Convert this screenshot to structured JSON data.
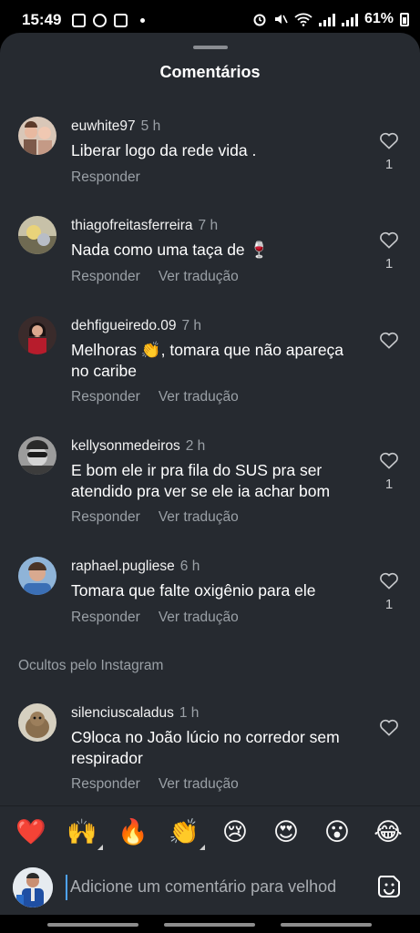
{
  "status_bar": {
    "time": "15:49",
    "battery": "61%"
  },
  "sheet": {
    "title": "Comentários"
  },
  "comments": [
    {
      "username": "euwhite97",
      "time": "5 h",
      "text": "Liberar logo da rede vida .",
      "reply": "Responder",
      "translate": "",
      "likes": "1"
    },
    {
      "username": "thiagofreitasferreira",
      "time": "7 h",
      "text": "Nada como uma taça de 🍷",
      "reply": "Responder",
      "translate": "Ver tradução",
      "likes": "1"
    },
    {
      "username": "dehfigueiredo.09",
      "time": "7 h",
      "text": "Melhoras 👏, tomara que não apareça no caribe",
      "reply": "Responder",
      "translate": "Ver tradução",
      "likes": ""
    },
    {
      "username": "kellysonmedeiros",
      "time": "2 h",
      "text": "E bom ele ir pra fila do SUS pra ser atendido pra ver se ele ia achar bom",
      "reply": "Responder",
      "translate": "Ver tradução",
      "likes": "1"
    },
    {
      "username": "raphael.pugliese",
      "time": "6 h",
      "text": "Tomara que falte oxigênio para ele",
      "reply": "Responder",
      "translate": "Ver tradução",
      "likes": "1"
    },
    {
      "username": "silenciuscaladus",
      "time": "1 h",
      "text": "C9loca no João lúcio no corredor sem respirador",
      "reply": "Responder",
      "translate": "Ver tradução",
      "likes": ""
    }
  ],
  "hidden_note": "Ocultos pelo Instagram",
  "emoji_reactions": [
    "❤️",
    "🙌",
    "🔥",
    "👏",
    "😢",
    "😍",
    "😮",
    "😂"
  ],
  "composer": {
    "placeholder": "Adicione um comentário para velhod"
  },
  "icons": {
    "like": "heart-outline-icon",
    "sticker": "sticker-icon"
  }
}
